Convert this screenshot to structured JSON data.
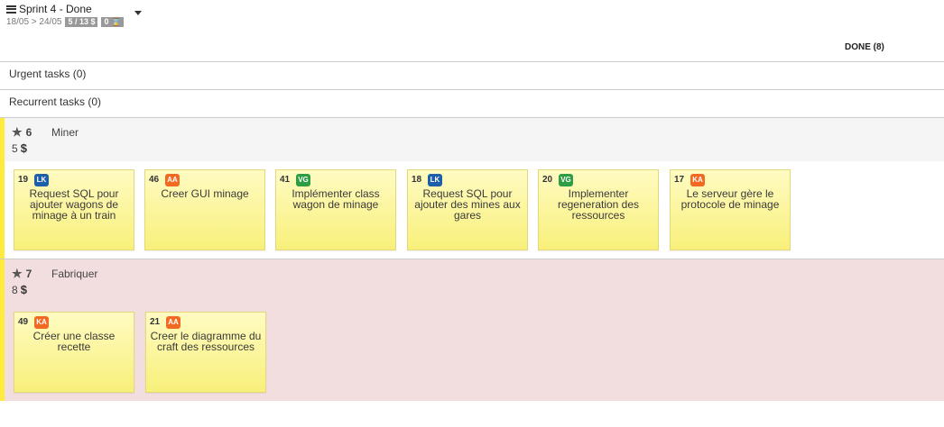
{
  "sprint": {
    "title": "Sprint 4 - Done",
    "dates": "18/05 > 24/05",
    "points_chip": "5 / 13 $",
    "tasks_chip": "0 ⌛"
  },
  "column": {
    "label": "DONE (8)"
  },
  "sections": {
    "urgent": "Urgent tasks (0)",
    "recurrent": "Recurrent tasks (0)"
  },
  "colors": {
    "story_bar": "#ffeb3b",
    "LK": "#1d5fa8",
    "AA": "#f26a21",
    "VG": "#2e9e44",
    "KA": "#f26a21"
  },
  "stories": [
    {
      "points": "6",
      "name": "Miner",
      "cost": "5",
      "cards": [
        {
          "id": "19",
          "user": "LK",
          "title": "Request SQL pour ajouter wagons de minage à un train"
        },
        {
          "id": "46",
          "user": "AA",
          "title": "Creer GUI minage"
        },
        {
          "id": "41",
          "user": "VG",
          "title": "Implémenter class wagon de minage"
        },
        {
          "id": "18",
          "user": "LK",
          "title": "Request SQL pour ajouter des mines aux gares"
        },
        {
          "id": "20",
          "user": "VG",
          "title": "Implementer regeneration des ressources"
        },
        {
          "id": "17",
          "user": "KA",
          "title": "Le serveur gère le protocole de minage"
        }
      ]
    },
    {
      "points": "7",
      "name": "Fabriquer",
      "cost": "8",
      "cards": [
        {
          "id": "49",
          "user": "KA",
          "title": "Créer une classe recette"
        },
        {
          "id": "21",
          "user": "AA",
          "title": "Creer le diagramme du craft des ressources"
        }
      ]
    }
  ]
}
